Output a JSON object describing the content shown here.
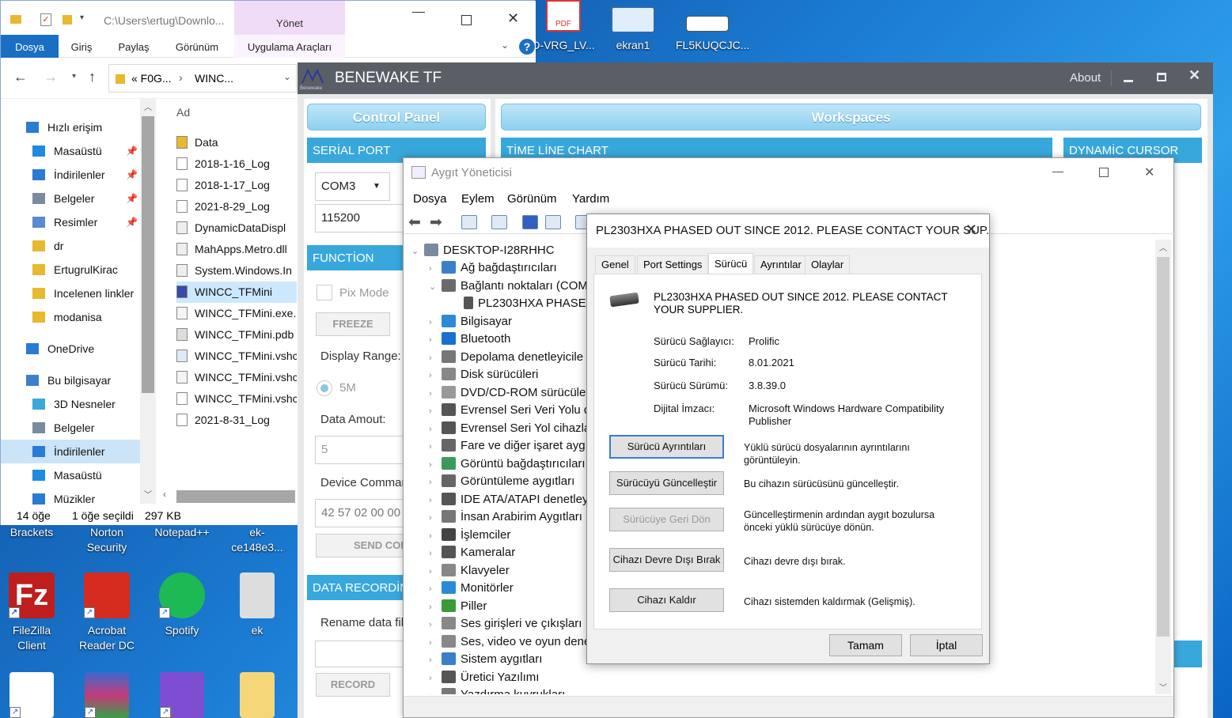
{
  "desktop": {
    "top_icons": [
      {
        "label": "D-VRG_LV...",
        "icon": "pdf-icon"
      },
      {
        "label": "ekran1",
        "icon": "image-icon"
      },
      {
        "label": "FL5KUQCJC...",
        "icon": "image-icon"
      }
    ],
    "left_icons_row1": [
      "Brackets",
      "Norton Security",
      "Notepad++",
      "ek-ce148e3..."
    ],
    "left_icons_row2": [
      {
        "label": "FileZilla Client",
        "color": "#bf1e1e"
      },
      {
        "label": "Acrobat Reader DC",
        "color": "#d62b1f"
      },
      {
        "label": "Spotify",
        "color": "#1db954"
      },
      {
        "label": "ek",
        "color": "#dddddd"
      }
    ],
    "left_icons_row3": [
      "unity-icon",
      "winrar-icon",
      "visual-studio-icon",
      "folder-icon"
    ],
    "pdf_badge": "PDF"
  },
  "explorer": {
    "path": "C:\\Users\\ertug\\Downlo...",
    "manage_tab": "Yönet",
    "ribbon_tabs": [
      "Dosya",
      "Giriş",
      "Paylaş",
      "Görünüm",
      "Uygulama Araçları"
    ],
    "breadcrumb": [
      "«  F0G...",
      "WINC..."
    ],
    "column_header": "Ad",
    "nav": [
      {
        "label": "Hızlı erişim",
        "indent": 0,
        "icon": "star-icon",
        "pin": false
      },
      {
        "label": "Masaüstü",
        "indent": 1,
        "icon": "desktop-icon",
        "pin": true
      },
      {
        "label": "İndirilenler",
        "indent": 1,
        "icon": "download-icon",
        "pin": true
      },
      {
        "label": "Belgeler",
        "indent": 1,
        "icon": "documents-icon",
        "pin": true
      },
      {
        "label": "Resimler",
        "indent": 1,
        "icon": "pictures-icon",
        "pin": true
      },
      {
        "label": "dr",
        "indent": 1,
        "icon": "folder-icon",
        "pin": false
      },
      {
        "label": "ErtugrulKirac",
        "indent": 1,
        "icon": "folder-icon",
        "pin": false
      },
      {
        "label": "Incelenen linkler",
        "indent": 1,
        "icon": "folder-icon",
        "pin": false
      },
      {
        "label": "modanisa",
        "indent": 1,
        "icon": "folder-icon",
        "pin": false
      },
      {
        "label": "OneDrive",
        "indent": 0,
        "icon": "cloud-icon",
        "pin": false
      },
      {
        "label": "Bu bilgisayar",
        "indent": 0,
        "icon": "computer-icon",
        "pin": false
      },
      {
        "label": "3D Nesneler",
        "indent": 1,
        "icon": "cube-icon",
        "pin": false
      },
      {
        "label": "Belgeler",
        "indent": 1,
        "icon": "documents-icon",
        "pin": false
      },
      {
        "label": "İndirilenler",
        "indent": 1,
        "icon": "download-icon",
        "pin": false
      },
      {
        "label": "Masaüstü",
        "indent": 1,
        "icon": "desktop-icon",
        "pin": false
      },
      {
        "label": "Müzikler",
        "indent": 1,
        "icon": "music-icon",
        "pin": false
      }
    ],
    "files": [
      {
        "name": "Data",
        "icon": "folder-icon"
      },
      {
        "name": "2018-1-16_Log",
        "icon": "text-file-icon"
      },
      {
        "name": "2018-1-17_Log",
        "icon": "text-file-icon"
      },
      {
        "name": "2021-8-29_Log",
        "icon": "text-file-icon"
      },
      {
        "name": "DynamicDataDispl",
        "icon": "dll-icon"
      },
      {
        "name": "MahApps.Metro.dll",
        "icon": "dll-icon"
      },
      {
        "name": "System.Windows.In",
        "icon": "dll-icon"
      },
      {
        "name": "WINCC_TFMini",
        "icon": "benewake-icon"
      },
      {
        "name": "WINCC_TFMini.exe.",
        "icon": "config-icon"
      },
      {
        "name": "WINCC_TFMini.pdb",
        "icon": "pdb-icon"
      },
      {
        "name": "WINCC_TFMini.vshc",
        "icon": "exe-icon"
      },
      {
        "name": "WINCC_TFMini.vshc",
        "icon": "config-icon"
      },
      {
        "name": "WINCC_TFMini.vshc",
        "icon": "blank-file-icon"
      },
      {
        "name": "2021-8-31_Log",
        "icon": "text-file-icon"
      }
    ],
    "status": {
      "count": "14 öğe",
      "selected": "1 öğe seçildi",
      "size": "297 KB"
    },
    "help": "?"
  },
  "benewake": {
    "title": "BENEWAKE TF",
    "logo_caption": "Benewake",
    "about": "About",
    "control_panel": "Control Panel",
    "workspaces": "Workspaces",
    "serial_port": {
      "title": "SERİAL PORT",
      "port": "COM3",
      "baud": "115200"
    },
    "function": {
      "title": "FUNCTİON",
      "pix_mode": "Pix Mode",
      "freeze": "FREEZE",
      "display_range": "Display Range:",
      "range_value": "5M",
      "data_amount": "Data Amout:",
      "data_amount_value": "5",
      "device_command": "Device Commar",
      "command_value": "42 57 02 00 00",
      "send": "SEND COM"
    },
    "data_recording": {
      "title": "DATA RECORDİNG",
      "rename": "Rename data fil",
      "record": "RECORD"
    },
    "timeline": "TİME LİNE CHART",
    "dynamic_cursor": "DYNAMİC CURSOR"
  },
  "devmgr": {
    "title": "Aygıt Yöneticisi",
    "menu": [
      "Dosya",
      "Eylem",
      "Görünüm",
      "Yardım"
    ],
    "root": "DESKTOP-I28RHHC",
    "items": [
      {
        "label": "Ağ bağdaştırıcıları",
        "level": 1,
        "expanded": false,
        "icon": "network-icon"
      },
      {
        "label": "Bağlantı noktaları (COM",
        "level": 1,
        "expanded": true,
        "icon": "port-icon"
      },
      {
        "label": "PL2303HXA PHASED",
        "level": 2,
        "expanded": false,
        "icon": "usb-plug-icon"
      },
      {
        "label": "Bilgisayar",
        "level": 1,
        "expanded": false,
        "icon": "monitor-icon"
      },
      {
        "label": "Bluetooth",
        "level": 1,
        "expanded": false,
        "icon": "bluetooth-icon"
      },
      {
        "label": "Depolama denetleyicile",
        "level": 1,
        "expanded": false,
        "icon": "storage-icon"
      },
      {
        "label": "Disk sürücüleri",
        "level": 1,
        "expanded": false,
        "icon": "disk-icon"
      },
      {
        "label": "DVD/CD-ROM sürücüle",
        "level": 1,
        "expanded": false,
        "icon": "dvd-icon"
      },
      {
        "label": "Evrensel Seri Veri Yolu d",
        "level": 1,
        "expanded": false,
        "icon": "usb-icon"
      },
      {
        "label": "Evrensel Seri Yol cihazla",
        "level": 1,
        "expanded": false,
        "icon": "usb-icon"
      },
      {
        "label": "Fare ve diğer işaret aygı",
        "level": 1,
        "expanded": false,
        "icon": "mouse-icon"
      },
      {
        "label": "Görüntü bağdaştırıcıları",
        "level": 1,
        "expanded": false,
        "icon": "display-adapter-icon"
      },
      {
        "label": "Görüntüleme aygıtları",
        "level": 1,
        "expanded": false,
        "icon": "camera-icon"
      },
      {
        "label": "IDE ATA/ATAPI denetleyi",
        "level": 1,
        "expanded": false,
        "icon": "ide-icon"
      },
      {
        "label": "İnsan Arabirim Aygıtları",
        "level": 1,
        "expanded": false,
        "icon": "hid-icon"
      },
      {
        "label": "İşlemciler",
        "level": 1,
        "expanded": false,
        "icon": "cpu-icon"
      },
      {
        "label": "Kameralar",
        "level": 1,
        "expanded": false,
        "icon": "webcam-icon"
      },
      {
        "label": "Klavyeler",
        "level": 1,
        "expanded": false,
        "icon": "keyboard-icon"
      },
      {
        "label": "Monitörler",
        "level": 1,
        "expanded": false,
        "icon": "monitor-icon"
      },
      {
        "label": "Piller",
        "level": 1,
        "expanded": false,
        "icon": "battery-icon"
      },
      {
        "label": "Ses girişleri ve çıkışları",
        "level": 1,
        "expanded": false,
        "icon": "speaker-icon"
      },
      {
        "label": "Ses, video ve oyun dene",
        "level": 1,
        "expanded": false,
        "icon": "speaker-icon"
      },
      {
        "label": "Sistem aygıtları",
        "level": 1,
        "expanded": false,
        "icon": "system-icon"
      },
      {
        "label": "Üretici Yazılımı",
        "level": 1,
        "expanded": false,
        "icon": "firmware-icon"
      },
      {
        "label": "Yazdırma kuyrukları",
        "level": 1,
        "expanded": false,
        "icon": "printer-icon"
      }
    ]
  },
  "props": {
    "title": "PL2303HXA PHASED OUT SINCE 2012. PLEASE CONTACT YOUR SUP...",
    "tabs": [
      "Genel",
      "Port Settings",
      "Sürücü",
      "Ayrıntılar",
      "Olaylar"
    ],
    "active_tab": 2,
    "device_name_line1": "PL2303HXA PHASED OUT SINCE 2012. PLEASE CONTACT",
    "device_name_line2": "YOUR SUPPLIER.",
    "fields": [
      {
        "key": "Sürücü Sağlayıcı:",
        "value": "Prolific"
      },
      {
        "key": "Sürücü Tarihi:",
        "value": "8.01.2021"
      },
      {
        "key": "Sürücü Sürümü:",
        "value": "3.8.39.0"
      },
      {
        "key": "Dijital İmzacı:",
        "value": "Microsoft Windows Hardware Compatibility Publisher"
      }
    ],
    "actions": [
      {
        "button": "Sürücü Ayrıntıları",
        "desc": "Yüklü sürücü dosyalarının ayrıntılarını görüntüleyin.",
        "state": "default"
      },
      {
        "button": "Sürücüyü Güncelleştir",
        "desc": "Bu cihazın sürücüsünü güncelleştir.",
        "state": "normal"
      },
      {
        "button": "Sürücüye Geri Dön",
        "desc": "Güncelleştirmenin ardından aygıt bozulursa önceki yüklü sürücüye dönün.",
        "state": "disabled"
      },
      {
        "button": "Cihazı Devre Dışı Bırak",
        "desc": "Cihazı devre dışı bırak.",
        "state": "normal"
      },
      {
        "button": "Cihazı Kaldır",
        "desc": "Cihazı sistemden kaldırmak (Gelişmiş).",
        "state": "normal"
      }
    ],
    "ok": "Tamam",
    "cancel": "İptal"
  },
  "colors": {
    "accent": "#38a7dc",
    "ribbon_blue": "#1a6fc4",
    "manage_tab": "#f1dcf8"
  }
}
